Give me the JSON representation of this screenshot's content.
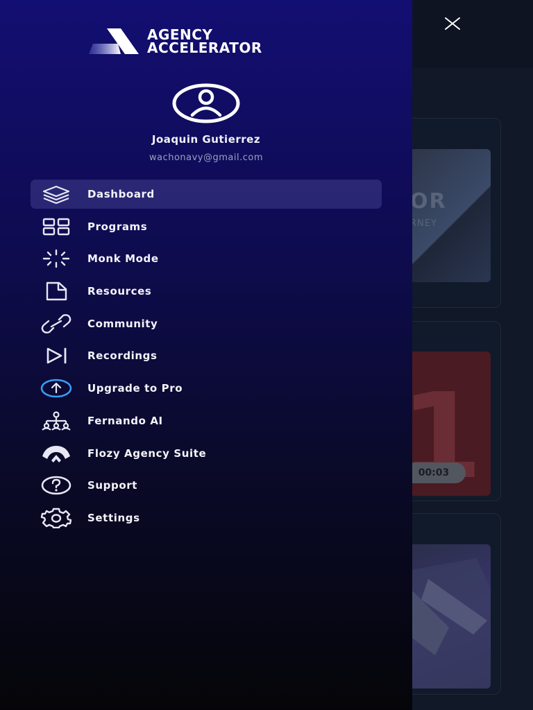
{
  "app": {
    "logo": {
      "line1": "AGENCY",
      "line2": "ACCELERATOR"
    }
  },
  "user": {
    "name": "Joaquin Gutierrez",
    "email": "wachonavy@gmail.com"
  },
  "menu": {
    "items": [
      {
        "label": "Dashboard",
        "icon": "layers-icon",
        "active": true
      },
      {
        "label": "Programs",
        "icon": "grid-icon"
      },
      {
        "label": "Monk Mode",
        "icon": "loader-icon"
      },
      {
        "label": "Resources",
        "icon": "file-icon"
      },
      {
        "label": "Community",
        "icon": "link-icon"
      },
      {
        "label": "Recordings",
        "icon": "skip-forward-icon"
      },
      {
        "label": "Upgrade to Pro",
        "icon": "upgrade-arrow-icon"
      },
      {
        "label": "Fernando AI",
        "icon": "network-icon"
      },
      {
        "label": "Flozy Agency Suite",
        "icon": "flozy-icon"
      },
      {
        "label": "Support",
        "icon": "help-icon"
      },
      {
        "label": "Settings",
        "icon": "gear-icon"
      }
    ]
  },
  "background": {
    "card1": {
      "text": "OR",
      "subtext": "RNEY"
    },
    "card2": {
      "big": "1",
      "timer": "00:03"
    }
  },
  "colors": {
    "drawer_top": "#130e72",
    "drawer_bottom": "#050509",
    "active_bg": "#3b3a8a",
    "upgrade_accent": "#3b9cf4",
    "text": "#ffffff",
    "muted": "#9aa0c0"
  }
}
